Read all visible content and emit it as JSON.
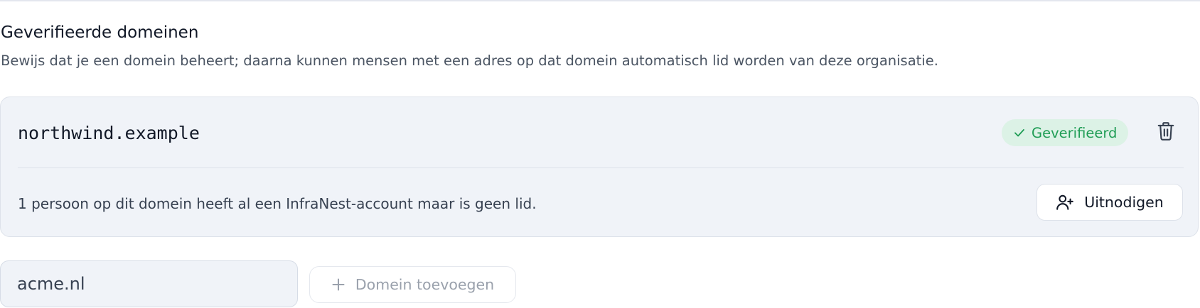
{
  "section": {
    "title": "Geverifieerde domeinen",
    "description": "Bewijs dat je een domein beheert; daarna kunnen mensen met een adres op dat domein automatisch lid worden van deze organisatie."
  },
  "domains": [
    {
      "name": "northwind.example",
      "status_label": "Geverifieerd",
      "status_color": "#1f9d55",
      "status_bg": "#dcf2e6",
      "delete_icon": "trash-icon",
      "notice": "1 persoon op dit domein heeft al een InfraNest-account maar is geen lid.",
      "invite_label": "Uitnodigen",
      "invite_icon": "user-plus-icon"
    }
  ],
  "add_domain": {
    "input_value": "acme.nl",
    "button_label": "Domein toevoegen",
    "button_icon": "plus-icon"
  }
}
